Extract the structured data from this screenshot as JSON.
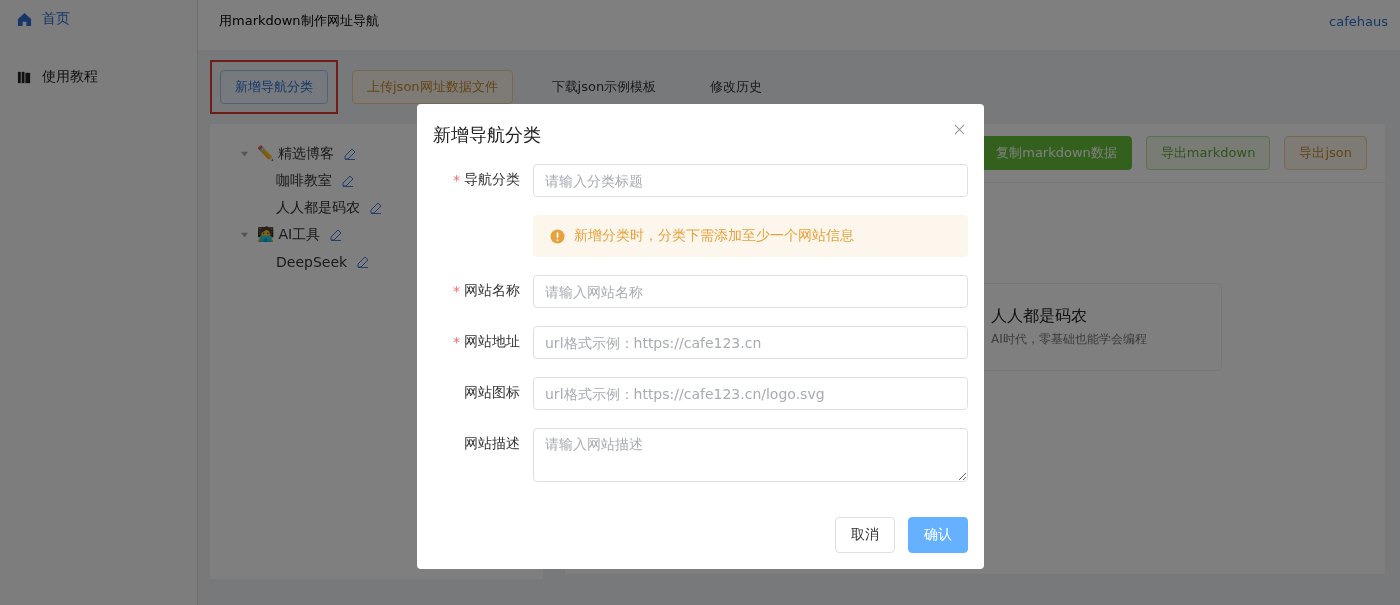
{
  "sidebar": {
    "items": [
      {
        "label": "首页",
        "selected": true
      },
      {
        "label": "使用教程",
        "selected": false
      }
    ]
  },
  "header": {
    "title": "用markdown制作网址导航",
    "user": "cafehaus"
  },
  "toolbar": [
    {
      "label": "新增导航分类",
      "kind": "primary-plain",
      "highlighted": true
    },
    {
      "label": "上传json网址数据文件",
      "kind": "warning-plain",
      "highlighted": false
    },
    {
      "label": "下载json示例模板",
      "kind": "text",
      "highlighted": false
    },
    {
      "label": "修改历史",
      "kind": "text",
      "highlighted": false
    }
  ],
  "tree": [
    {
      "label": "精选博客",
      "emoji": "✏️",
      "expanded": true,
      "children": [
        {
          "label": "咖啡教室"
        },
        {
          "label": "人人都是码农"
        }
      ]
    },
    {
      "label": "AI工具",
      "emoji": "🧑‍💻",
      "expanded": true,
      "children": [
        {
          "label": "DeepSeek"
        }
      ]
    }
  ],
  "actions": [
    {
      "label": "复制markdown数据",
      "kind": "success"
    },
    {
      "label": "导出markdown",
      "kind": "success-plain"
    },
    {
      "label": "导出json",
      "kind": "warning-plain"
    }
  ],
  "site_card": {
    "title": "人人都是码农",
    "description": "AI时代，零基础也能学会编程"
  },
  "dialog": {
    "title": "新增导航分类",
    "fields": [
      {
        "label": "导航分类",
        "placeholder": "请输入分类标题",
        "mark": "*",
        "kind": "input"
      },
      {
        "kind": "alert",
        "text": "新增分类时，分类下需添加至少一个网站信息"
      },
      {
        "label": "网站名称",
        "placeholder": "请输入网站名称",
        "mark": "*",
        "kind": "input"
      },
      {
        "label": "网站地址",
        "placeholder": "url格式示例：https://cafe123.cn",
        "mark": "*",
        "kind": "input"
      },
      {
        "label": "网站图标",
        "placeholder": "url格式示例：https://cafe123.cn/logo.svg",
        "kind": "input"
      },
      {
        "label": "网站描述",
        "placeholder": "请输入网站描述",
        "kind": "textarea"
      }
    ],
    "buttons": [
      {
        "label": "取消",
        "kind": "default"
      },
      {
        "label": "确认",
        "kind": "primary"
      }
    ]
  }
}
